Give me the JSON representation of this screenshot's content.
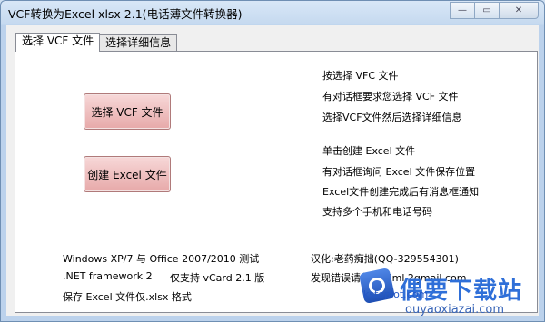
{
  "window": {
    "title": "VCF转换为Excel xlsx 2.1(电话薄文件转换器)",
    "minimize_label": "—",
    "maximize_label": "▭",
    "close_label": "✕"
  },
  "tabs": [
    {
      "label": "选择 VCF 文件",
      "active": true
    },
    {
      "label": "选择详细信息",
      "active": false
    }
  ],
  "buttons": {
    "select_vcf": "选择 VCF 文件",
    "create_excel": "创建 Excel 文件"
  },
  "instructions": {
    "line1": "按选择 VFC 文件",
    "line2": "有对话框要求您选择 VCF 文件",
    "line3": "选择VCF文件然后选择详细信息",
    "line4": "单击创建 Excel 文件",
    "line5": "有对话框询问 Excel 文件保存位置",
    "line6": "Excel文件创建完成后有消息框通知",
    "line7": "支持多个手机和电话号码"
  },
  "info": {
    "compat": "Windows XP/7 与 Office 2007/2010 测试",
    "framework": ".NET framework 2",
    "vcard": "仅支持 vCard 2.1 版",
    "save": "保存 Excel 文件仅.xlsx 格式",
    "translator": "汉化:老药痴拙(QQ-329554301)",
    "feedback": "发现错误请邮:2.kiml.2gmail.com"
  },
  "watermark": {
    "title": "偶要下载站",
    "subtitle": "ouyaoxiazai.com",
    "url": "kstoplot.com"
  },
  "colors": {
    "button_top": "#f7d8d8",
    "button_bottom": "#e7a9a9",
    "watermark_blue": "#2f6fd8"
  }
}
